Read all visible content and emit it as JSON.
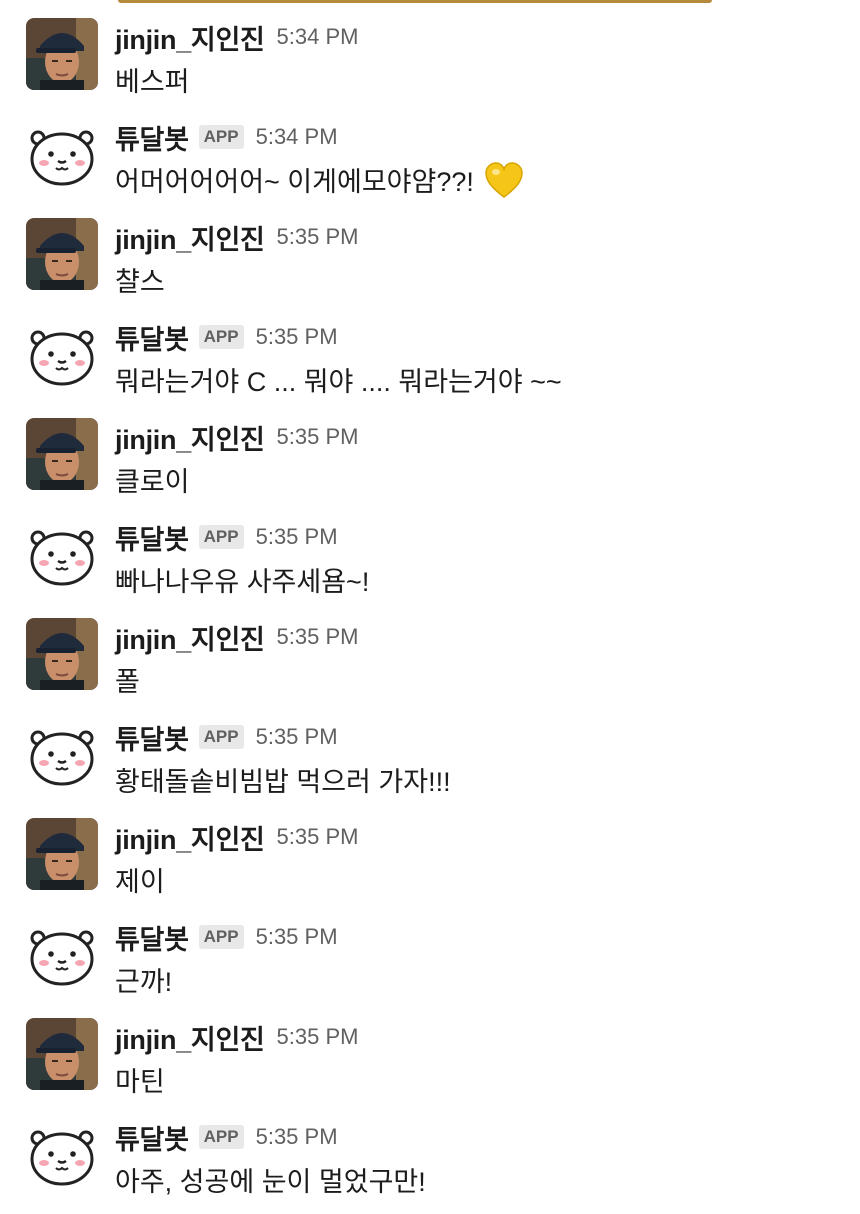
{
  "messages": [
    {
      "sender": "jinjin_지인진",
      "kind": "user",
      "time": "5:34 PM",
      "text": "베스퍼"
    },
    {
      "sender": "튜달봇",
      "kind": "bot",
      "badge": "APP",
      "time": "5:34 PM",
      "text": "어머어어어어~ 이게에모야얌??!",
      "emoji": "yellow-heart-icon"
    },
    {
      "sender": "jinjin_지인진",
      "kind": "user",
      "time": "5:35 PM",
      "text": "챨스"
    },
    {
      "sender": "튜달봇",
      "kind": "bot",
      "badge": "APP",
      "time": "5:35 PM",
      "text": "뭐라는거야 C ... 뭐야 .... 뭐라는거야 ~~"
    },
    {
      "sender": "jinjin_지인진",
      "kind": "user",
      "time": "5:35 PM",
      "text": "클로이"
    },
    {
      "sender": "튜달봇",
      "kind": "bot",
      "badge": "APP",
      "time": "5:35 PM",
      "text": "빠나나우유 사주세욤~!"
    },
    {
      "sender": "jinjin_지인진",
      "kind": "user",
      "time": "5:35 PM",
      "text": "폴"
    },
    {
      "sender": "튜달봇",
      "kind": "bot",
      "badge": "APP",
      "time": "5:35 PM",
      "text": "황태돌솥비빔밥 먹으러 가자!!!"
    },
    {
      "sender": "jinjin_지인진",
      "kind": "user",
      "time": "5:35 PM",
      "text": "제이"
    },
    {
      "sender": "튜달봇",
      "kind": "bot",
      "badge": "APP",
      "time": "5:35 PM",
      "text": "근까!"
    },
    {
      "sender": "jinjin_지인진",
      "kind": "user",
      "time": "5:35 PM",
      "text": "마틴"
    },
    {
      "sender": "튜달봇",
      "kind": "bot",
      "badge": "APP",
      "time": "5:35 PM",
      "text": "아주, 성공에 눈이 멀었구만!"
    }
  ],
  "colors": {
    "text": "#1d1c1d",
    "muted": "#616061",
    "badge_bg": "#e8e8e8",
    "heart": "#f5c518"
  }
}
